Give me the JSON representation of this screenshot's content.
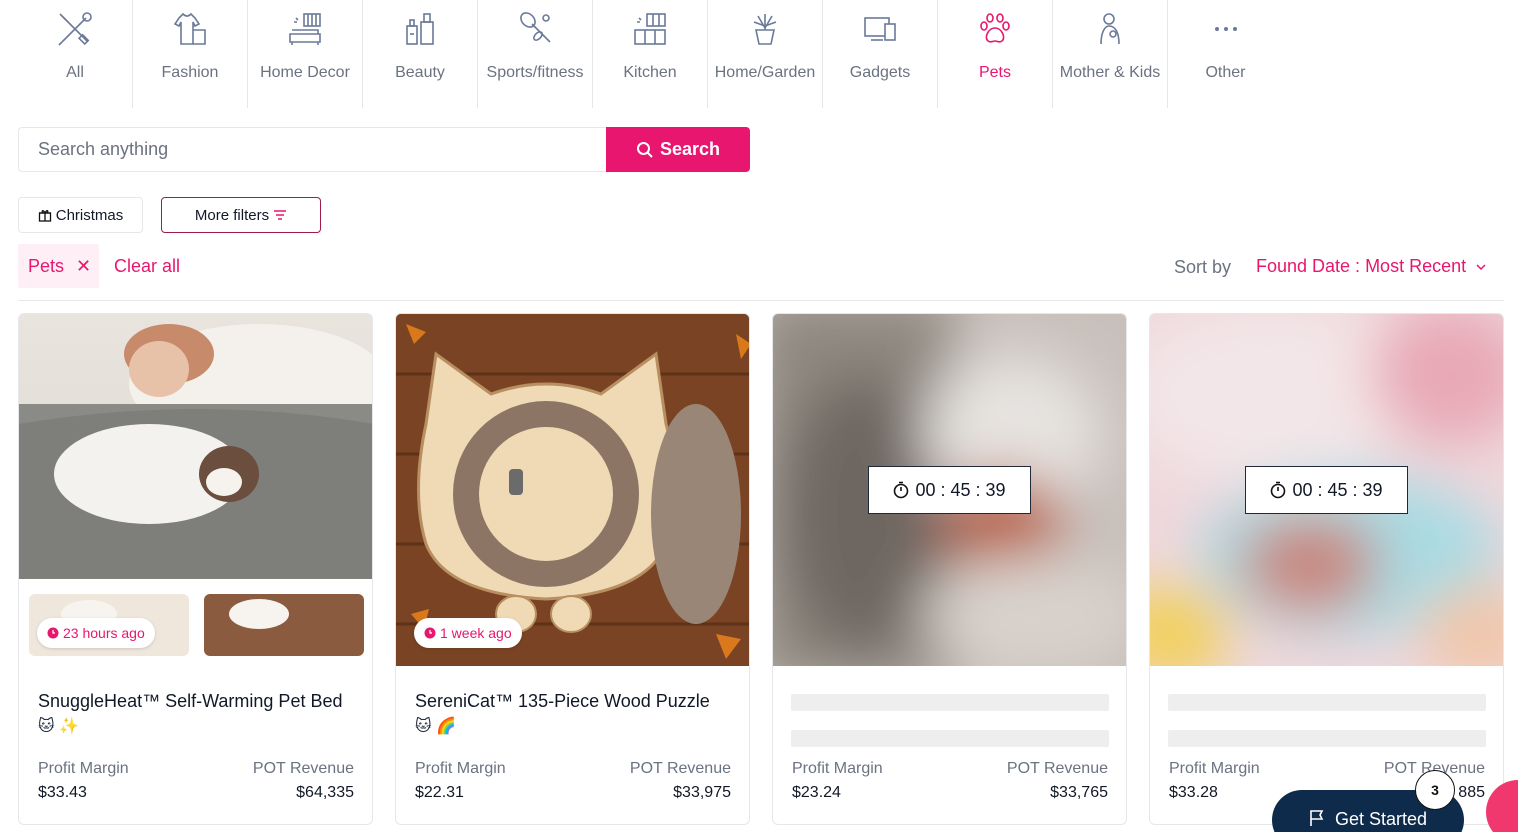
{
  "categories": [
    {
      "label": "All",
      "icon": "tools-icon",
      "active": false
    },
    {
      "label": "Fashion",
      "icon": "clothes-icon",
      "active": false
    },
    {
      "label": "Home Decor",
      "icon": "sofa-icon",
      "active": false
    },
    {
      "label": "Beauty",
      "icon": "cosmetics-icon",
      "active": false
    },
    {
      "label": "Sports/fitness",
      "icon": "racket-icon",
      "active": false
    },
    {
      "label": "Kitchen",
      "icon": "kitchen-icon",
      "active": false
    },
    {
      "label": "Home/Garden",
      "icon": "plant-icon",
      "active": false
    },
    {
      "label": "Gadgets",
      "icon": "devices-icon",
      "active": false
    },
    {
      "label": "Pets",
      "icon": "paw-icon",
      "active": true
    },
    {
      "label": "Mother & Kids",
      "icon": "mother-icon",
      "active": false
    },
    {
      "label": "Other",
      "icon": "more-dots-icon",
      "active": false
    }
  ],
  "search": {
    "placeholder": "Search anything",
    "value": "",
    "button_label": "Search"
  },
  "filters": {
    "christmas_label": "Christmas",
    "more_filters_label": "More filters"
  },
  "active_filter": {
    "label": "Pets",
    "remove_symbol": "✕"
  },
  "clear_all_label": "Clear all",
  "sort": {
    "label": "Sort by",
    "value": "Found Date : Most Recent"
  },
  "colors": {
    "accent": "#e8166e",
    "navy": "#0f2b4c"
  },
  "products": [
    {
      "title": "SnuggleHeat™ Self-Warming Pet Bed",
      "emoji": "🐱 ✨",
      "badge": "23 hours ago",
      "locked": false,
      "profit_label": "Profit Margin",
      "profit": "$33.43",
      "revenue_label": "POT Revenue",
      "revenue": "$64,335"
    },
    {
      "title": "SereniCat™ 135-Piece Wood Puzzle",
      "emoji": "🐱 🌈",
      "badge": "1 week ago",
      "locked": false,
      "profit_label": "Profit Margin",
      "profit": "$22.31",
      "revenue_label": "POT Revenue",
      "revenue": "$33,975"
    },
    {
      "timer": "00 : 45 : 39",
      "locked": true,
      "profit_label": "Profit Margin",
      "profit": "$23.24",
      "revenue_label": "POT Revenue",
      "revenue": "$33,765"
    },
    {
      "timer": "00 : 45 : 39",
      "locked": true,
      "profit_label": "Profit Margin",
      "profit": "$33.28",
      "revenue_label": "POT Revenue",
      "revenue": "885"
    }
  ],
  "get_started": {
    "label": "Get Started",
    "count": "3"
  }
}
